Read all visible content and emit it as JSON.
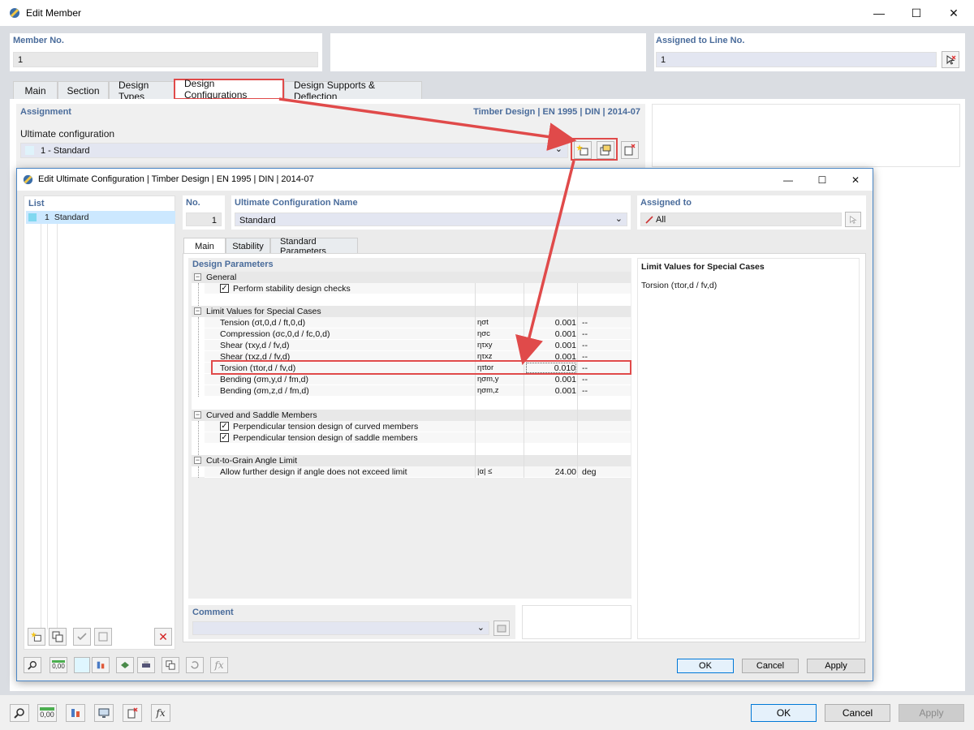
{
  "window": {
    "title": "Edit Member",
    "minimize_glyph": "—",
    "maximize_glyph": "☐",
    "close_glyph": "✕"
  },
  "member": {
    "number_label": "Member No.",
    "number_value": "1",
    "assigned_label": "Assigned to Line No.",
    "assigned_value": "1"
  },
  "tabs": [
    {
      "label": "Main"
    },
    {
      "label": "Section"
    },
    {
      "label": "Design Types"
    },
    {
      "label": "Design Configurations"
    },
    {
      "label": "Design Supports & Deflection"
    }
  ],
  "assignment": {
    "label": "Assignment",
    "standard_info": "Timber Design | EN 1995 | DIN | 2014-07",
    "ultimate_label": "Ultimate configuration",
    "ultimate_value": "1 - Standard"
  },
  "dialog": {
    "title": "Edit Ultimate Configuration | Timber Design | EN 1995 | DIN | 2014-07",
    "list_label": "List",
    "list_items": [
      {
        "no": "1",
        "name": "Standard"
      }
    ],
    "no_label": "No.",
    "no_value": "1",
    "name_label": "Ultimate Configuration Name",
    "name_value": "Standard",
    "assigned_label": "Assigned to",
    "assigned_value": "All",
    "tabs": [
      {
        "label": "Main"
      },
      {
        "label": "Stability"
      },
      {
        "label": "Standard Parameters"
      }
    ],
    "params_label": "Design Parameters",
    "groups": {
      "general": {
        "title": "General",
        "items": [
          {
            "label": "Perform stability design checks",
            "checked": true
          }
        ]
      },
      "limits": {
        "title": "Limit Values for Special Cases",
        "rows": [
          {
            "label": "Tension (σt,0,d / ft,0,d)",
            "symbol": "ησt",
            "value": "0.001",
            "unit": "--"
          },
          {
            "label": "Compression (σc,0,d / fc,0,d)",
            "symbol": "ησc",
            "value": "0.001",
            "unit": "--"
          },
          {
            "label": "Shear (τxy,d / fv,d)",
            "symbol": "ητxy",
            "value": "0.001",
            "unit": "--"
          },
          {
            "label": "Shear (τxz,d / fv,d)",
            "symbol": "ητxz",
            "value": "0.001",
            "unit": "--"
          },
          {
            "label": "Torsion (τtor,d / fv,d)",
            "symbol": "ητtor",
            "value": "0.010",
            "unit": "--"
          },
          {
            "label": "Bending (σm,y,d / fm,d)",
            "symbol": "ησm,y",
            "value": "0.001",
            "unit": "--"
          },
          {
            "label": "Bending (σm,z,d / fm,d)",
            "symbol": "ησm,z",
            "value": "0.001",
            "unit": "--"
          }
        ]
      },
      "curved": {
        "title": "Curved and Saddle Members",
        "items": [
          {
            "label": "Perpendicular tension design of curved members",
            "checked": true
          },
          {
            "label": "Perpendicular tension design of saddle members",
            "checked": true
          }
        ]
      },
      "grain": {
        "title": "Cut-to-Grain Angle Limit",
        "row": {
          "label": "Allow further design if angle does not exceed limit",
          "symbol": "|α| ≤",
          "value": "24.00",
          "unit": "deg"
        }
      }
    },
    "info_title": "Limit Values for Special Cases",
    "info_text": "Torsion (τtor,d / fv,d)",
    "comment_label": "Comment",
    "ok_label": "OK",
    "cancel_label": "Cancel",
    "apply_label": "Apply"
  },
  "footer": {
    "ok_label": "OK",
    "cancel_label": "Cancel",
    "apply_label": "Apply",
    "zero_badge": "0,00"
  },
  "icons": {
    "checkmark": "✓",
    "collapse": "−",
    "dropdown": "⌄",
    "delete": "✕"
  },
  "colors": {
    "highlight_red": "#e04a4a",
    "section_blue": "#4a6c9b",
    "list_selected": "#cce8ff"
  }
}
